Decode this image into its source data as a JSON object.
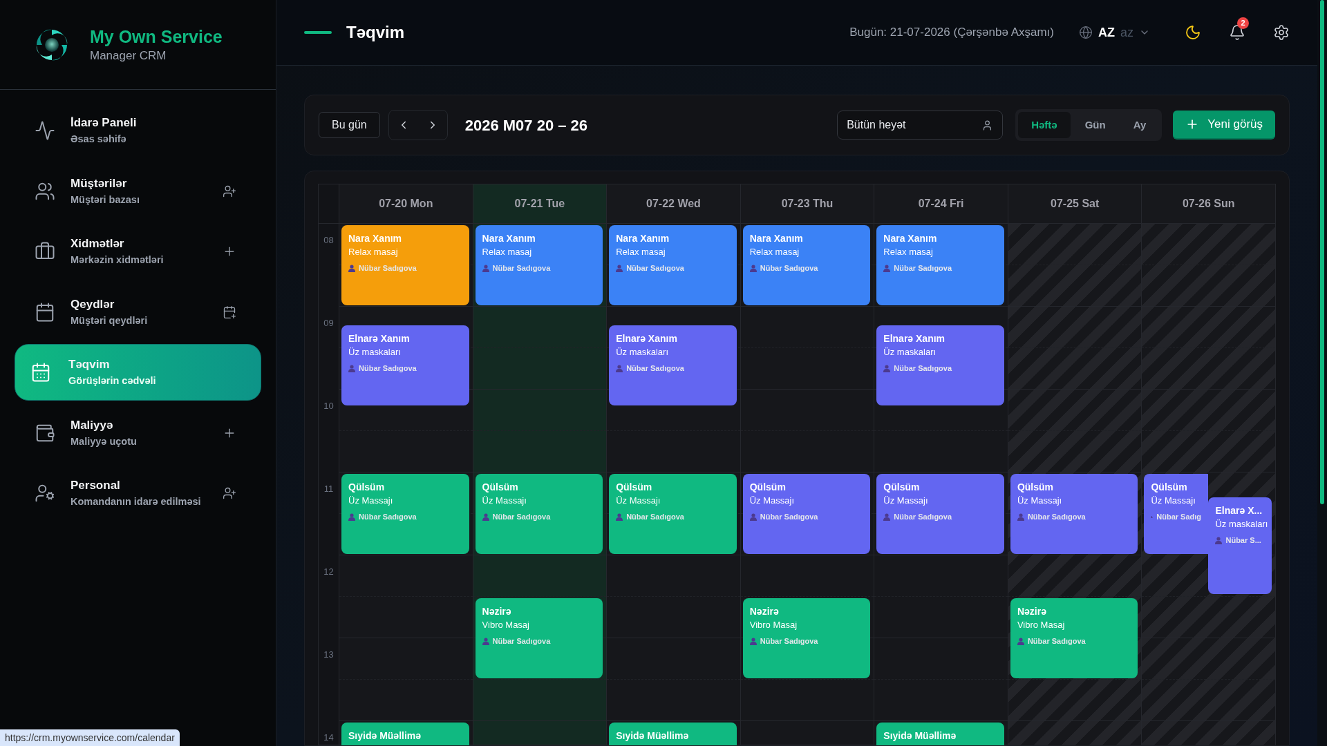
{
  "sidebar": {
    "brand": {
      "title": "My Own Service",
      "subtitle": "Manager CRM"
    },
    "items": [
      {
        "title": "İdarə Paneli",
        "subtitle": "Əsas səhifə",
        "selected": false
      },
      {
        "title": "Müştərilər",
        "subtitle": "Müştəri bazası",
        "selected": false
      },
      {
        "title": "Xidmətlər",
        "subtitle": "Mərkəzin xidmətləri",
        "selected": false
      },
      {
        "title": "Qeydlər",
        "subtitle": "Müştəri qeydləri",
        "selected": false
      },
      {
        "title": "Təqvim",
        "subtitle": "Görüşlərin cədvəli",
        "selected": true
      },
      {
        "title": "Maliyyə",
        "subtitle": "Maliyyə uçotu",
        "selected": false
      },
      {
        "title": "Personal",
        "subtitle": "Komandanın idarə edilməsi",
        "selected": false
      }
    ]
  },
  "header": {
    "title": "Təqvim",
    "today": "Bugün: 21-07-2026 (Çərşənbə Axşamı)",
    "language": "AZ",
    "language_alt": "az",
    "notifications": "2"
  },
  "toolbar": {
    "today_button": "Bu gün",
    "range": "2026 M07 20 – 26",
    "staff_select": "Bütün heyət",
    "views": [
      {
        "label": "Həftə",
        "selected": true
      },
      {
        "label": "Gün",
        "selected": false
      },
      {
        "label": "Ay",
        "selected": false
      }
    ],
    "new_button": "Yeni görüş"
  },
  "calendar": {
    "hours": [
      "08",
      "09",
      "10",
      "11",
      "12",
      "13",
      "14"
    ],
    "days": [
      {
        "label": "07-20 Mon",
        "today": false,
        "off": false,
        "events": [
          {
            "name": "Nara Xanım",
            "service": "Relax masaj",
            "staff": "Nübar Sadıgova",
            "color": "#f59e0b",
            "overlap": false
          },
          {
            "name": "Elnarə Xanım",
            "service": "Üz maskaları",
            "staff": "Nübar Sadıgova",
            "color": "#6366f1",
            "overlap": false
          },
          {
            "name": "Qülsüm",
            "service": "Üz Massajı",
            "staff": "Nübar Sadıgova",
            "color": "#10b981",
            "overlap": false
          },
          {
            "name": "Sıyidə Müəllimə",
            "color": "#10b981",
            "overlap": false
          }
        ]
      },
      {
        "label": "07-21 Tue",
        "today": true,
        "off": false,
        "events": [
          {
            "name": "Nara Xanım",
            "service": "Relax masaj",
            "staff": "Nübar Sadıgova",
            "color": "#3b82f6",
            "overlap": false
          },
          {
            "name": "Qülsüm",
            "service": "Üz Massajı",
            "staff": "Nübar Sadıgova",
            "color": "#10b981",
            "overlap": false
          },
          {
            "name": "Nəzirə",
            "service": "Vibro Masaj",
            "staff": "Nübar Sadıgova",
            "color": "#10b981",
            "overlap": false
          }
        ]
      },
      {
        "label": "07-22 Wed",
        "today": false,
        "off": false,
        "events": [
          {
            "name": "Nara Xanım",
            "service": "Relax masaj",
            "staff": "Nübar Sadıgova",
            "color": "#3b82f6",
            "overlap": false
          },
          {
            "name": "Elnarə Xanım",
            "service": "Üz maskaları",
            "staff": "Nübar Sadıgova",
            "color": "#6366f1",
            "overlap": false
          },
          {
            "name": "Qülsüm",
            "service": "Üz Massajı",
            "staff": "Nübar Sadıgova",
            "color": "#10b981",
            "overlap": false
          },
          {
            "name": "Sıyidə Müəllimə",
            "color": "#10b981",
            "overlap": false
          }
        ]
      },
      {
        "label": "07-23 Thu",
        "today": false,
        "off": false,
        "events": [
          {
            "name": "Nara Xanım",
            "service": "Relax masaj",
            "staff": "Nübar Sadıgova",
            "color": "#3b82f6",
            "overlap": false
          },
          {
            "name": "Qülsüm",
            "service": "Üz Massajı",
            "staff": "Nübar Sadıgova",
            "color": "#6366f1",
            "overlap": false
          },
          {
            "name": "Nəzirə",
            "service": "Vibro Masaj",
            "staff": "Nübar Sadıgova",
            "color": "#10b981",
            "overlap": false
          }
        ]
      },
      {
        "label": "07-24 Fri",
        "today": false,
        "off": false,
        "events": [
          {
            "name": "Nara Xanım",
            "service": "Relax masaj",
            "staff": "Nübar Sadıgova",
            "color": "#3b82f6",
            "overlap": false
          },
          {
            "name": "Elnarə Xanım",
            "service": "Üz maskaları",
            "staff": "Nübar Sadıgova",
            "color": "#6366f1",
            "overlap": false
          },
          {
            "name": "Qülsüm",
            "service": "Üz Massajı",
            "staff": "Nübar Sadıgova",
            "color": "#6366f1",
            "overlap": false
          },
          {
            "name": "Sıyidə Müəllimə",
            "color": "#10b981",
            "overlap": false
          }
        ]
      },
      {
        "label": "07-25 Sat",
        "today": false,
        "off": true,
        "events": [
          {
            "name": "Qülsüm",
            "service": "Üz Massajı",
            "staff": "Nübar Sadıgova",
            "color": "#6366f1",
            "overlap": false
          },
          {
            "name": "Nəzirə",
            "service": "Vibro Masaj",
            "staff": "Nübar Sadıgova",
            "color": "#10b981",
            "overlap": false
          }
        ]
      },
      {
        "label": "07-26 Sun",
        "today": false,
        "off": true,
        "events": [
          {
            "name": "Qülsüm",
            "service": "Üz Massajı",
            "staff": "Nübar Sadıg",
            "color": "#6366f1",
            "overlap": false
          },
          {
            "name": "Elnarə X...",
            "service": "Üz maskaları",
            "staff": "Nübar S...",
            "color": "#6366f1",
            "overlap": true
          }
        ]
      }
    ]
  },
  "status_url": "https://crm.myownservice.com/calendar"
}
